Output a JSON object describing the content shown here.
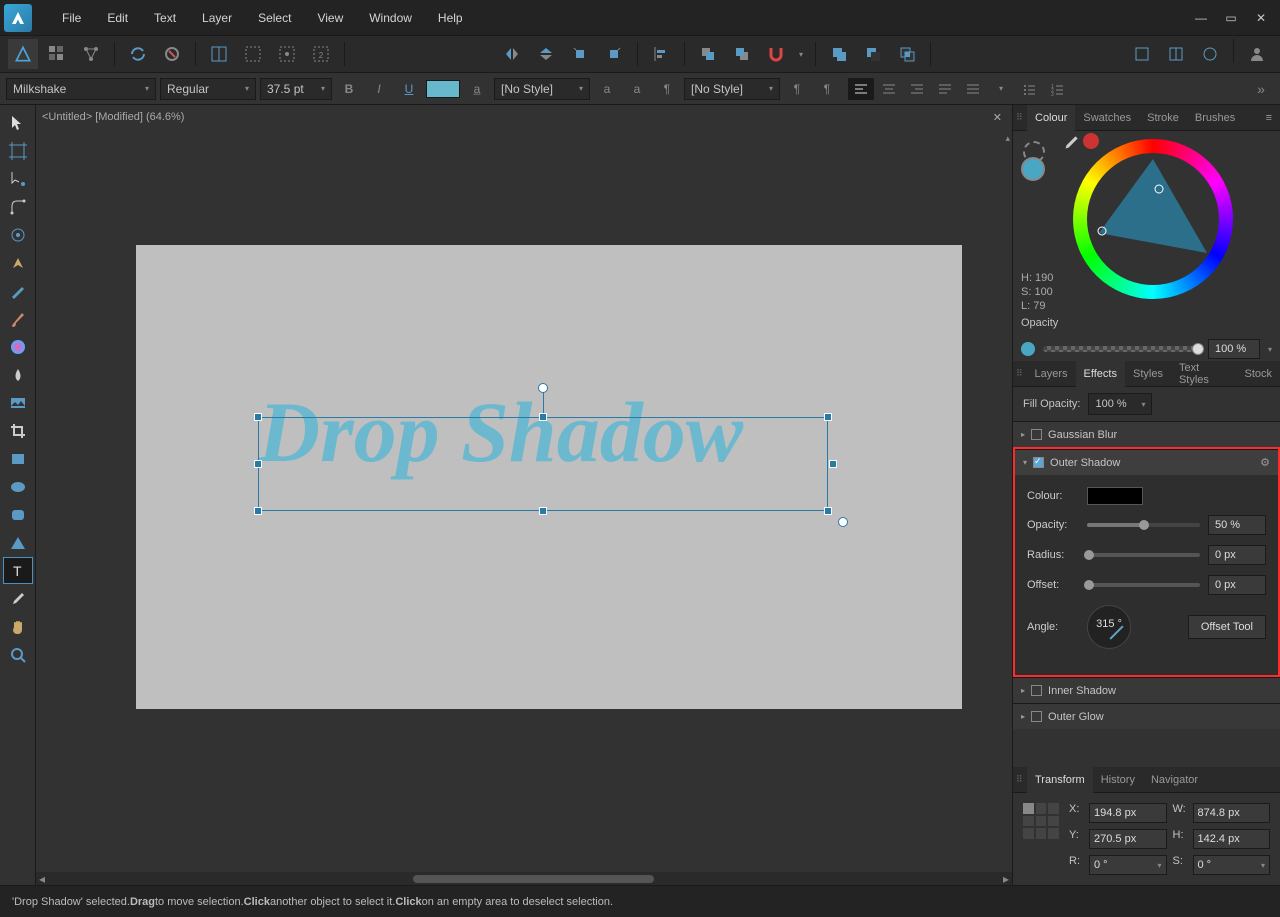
{
  "menu": {
    "items": [
      "File",
      "Edit",
      "Text",
      "Layer",
      "Select",
      "View",
      "Window",
      "Help"
    ]
  },
  "context": {
    "font": "Milkshake",
    "weight": "Regular",
    "size": "37.5 pt",
    "charStyle": "[No Style]",
    "paraStyle": "[No Style]",
    "fillColor": "#67b8cc"
  },
  "doc": {
    "tab": "<Untitled> [Modified] (64.6%)"
  },
  "canvas": {
    "text": "Drop Shadow"
  },
  "colorPanel": {
    "tabs": [
      "Colour",
      "Swatches",
      "Stroke",
      "Brushes"
    ],
    "h": "H: 190",
    "s": "S: 100",
    "l": "L: 79",
    "opacityLabel": "Opacity",
    "opacityVal": "100 %"
  },
  "layerTabs": [
    "Layers",
    "Effects",
    "Styles",
    "Text Styles",
    "Stock"
  ],
  "fillOpacity": {
    "label": "Fill Opacity:",
    "val": "100 %"
  },
  "effects": {
    "gaussian": "Gaussian Blur",
    "outer": {
      "title": "Outer Shadow",
      "color": "Colour:",
      "colorVal": "#000000",
      "opacity": "Opacity:",
      "opacityVal": "50 %",
      "radius": "Radius:",
      "radiusVal": "0 px",
      "offset": "Offset:",
      "offsetVal": "0 px",
      "angle": "Angle:",
      "angleVal": "315 °",
      "offsetTool": "Offset Tool"
    },
    "inner": "Inner Shadow",
    "outerGlow": "Outer Glow"
  },
  "transformTabs": [
    "Transform",
    "History",
    "Navigator"
  ],
  "transform": {
    "xLabel": "X:",
    "x": "194.8 px",
    "wLabel": "W:",
    "w": "874.8 px",
    "yLabel": "Y:",
    "y": "270.5 px",
    "hLabel": "H:",
    "h": "142.4 px",
    "rLabel": "R:",
    "r": "0 °",
    "sLabel": "S:",
    "s": "0 °"
  },
  "status": {
    "p1": "'Drop Shadow' selected. ",
    "b1": "Drag",
    "p2": " to move selection. ",
    "b2": "Click",
    "p3": " another object to select it. ",
    "b3": "Click",
    "p4": " on an empty area to deselect selection."
  }
}
